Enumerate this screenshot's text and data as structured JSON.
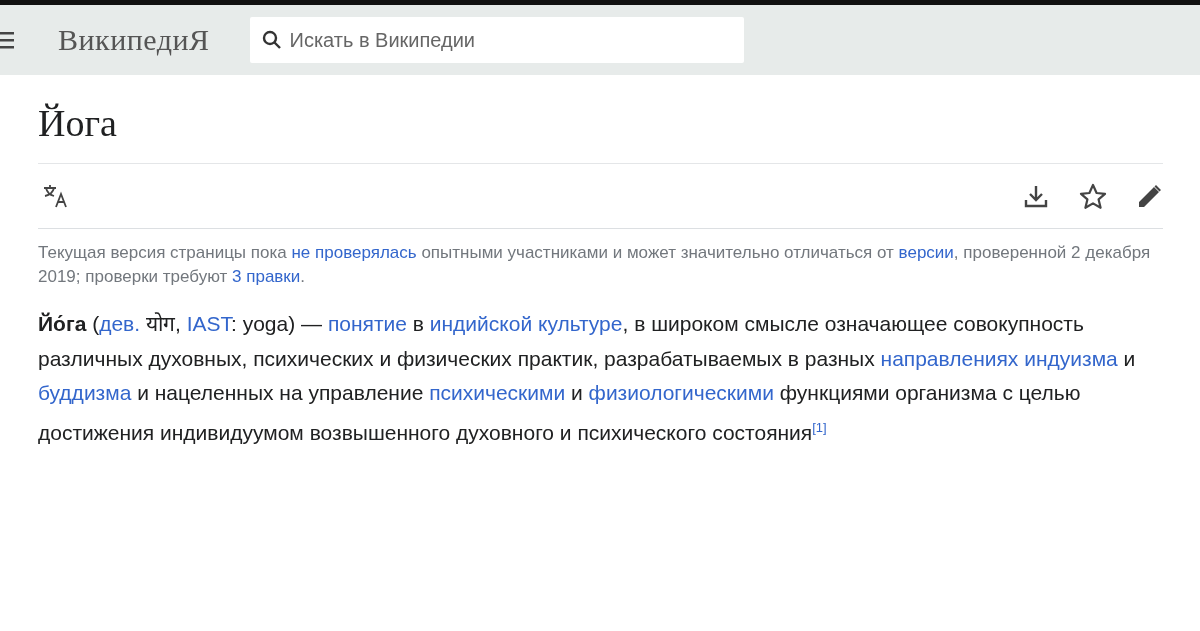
{
  "header": {
    "logo": "ВикипедиЯ",
    "search": {
      "placeholder": "Искать в Википедии"
    }
  },
  "title": "Йога",
  "notice": [
    {
      "kind": "text",
      "text": "Текущая версия страницы пока "
    },
    {
      "kind": "link",
      "text": "не проверялась"
    },
    {
      "kind": "text",
      "text": " опытными участниками и может значительно отличаться от "
    },
    {
      "kind": "link",
      "text": "версии"
    },
    {
      "kind": "text",
      "text": ", проверенной 2 декабря 2019; проверки требуют "
    },
    {
      "kind": "link",
      "text": "3 правки"
    },
    {
      "kind": "text",
      "text": "."
    }
  ],
  "paragraph": [
    {
      "kind": "bold",
      "text": "Йо́га"
    },
    {
      "kind": "text",
      "text": " ("
    },
    {
      "kind": "link",
      "text": "дев."
    },
    {
      "kind": "text",
      "text": " योग, "
    },
    {
      "kind": "link",
      "text": "IAST"
    },
    {
      "kind": "text",
      "text": ": yoga) — "
    },
    {
      "kind": "link",
      "text": "понятие"
    },
    {
      "kind": "text",
      "text": " в "
    },
    {
      "kind": "link",
      "text": "индийской культуре"
    },
    {
      "kind": "text",
      "text": ", в широком смысле означающее совокупность различных духовных, психических и физических практик, разрабатываемых в разных "
    },
    {
      "kind": "link",
      "text": "направлениях индуизма"
    },
    {
      "kind": "text",
      "text": " и "
    },
    {
      "kind": "link",
      "text": "буддизма"
    },
    {
      "kind": "text",
      "text": " и нацеленных на управление "
    },
    {
      "kind": "link",
      "text": "психическими"
    },
    {
      "kind": "text",
      "text": " и "
    },
    {
      "kind": "link",
      "text": "физиологическими"
    },
    {
      "kind": "text",
      "text": " функциями организма с целью достижения индивидуумом возвышенного духовного и психического состояния"
    },
    {
      "kind": "ref",
      "text": "[1]"
    }
  ]
}
